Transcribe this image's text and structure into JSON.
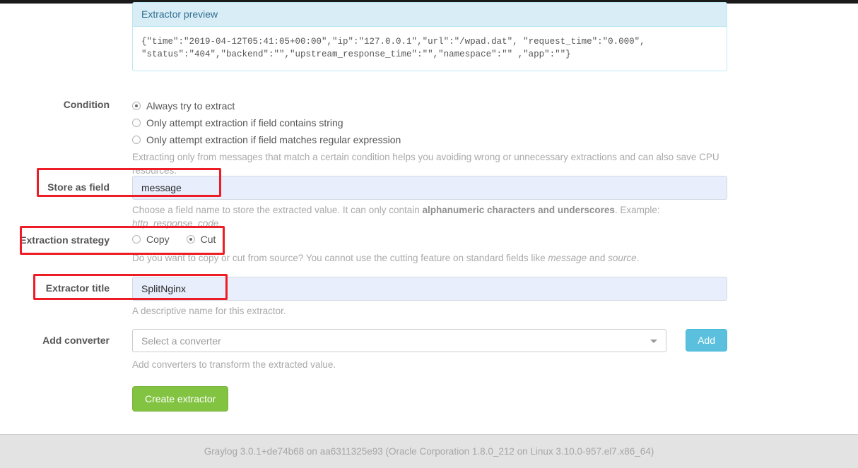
{
  "preview": {
    "heading": "Extractor preview",
    "content": "{\"time\":\"2019-04-12T05:41:05+00:00\",\"ip\":\"127.0.0.1\",\"url\":\"/wpad.dat\", \"request_time\":\"0.000\",\n\"status\":\"404\",\"backend\":\"\",\"upstream_response_time\":\"\",\"namespace\":\"\" ,\"app\":\"\"}"
  },
  "condition": {
    "label": "Condition",
    "options": [
      {
        "label": "Always try to extract",
        "checked": true
      },
      {
        "label": "Only attempt extraction if field contains string",
        "checked": false
      },
      {
        "label": "Only attempt extraction if field matches regular expression",
        "checked": false
      }
    ],
    "help": "Extracting only from messages that match a certain condition helps you avoiding wrong or unnecessary extractions and can also save CPU resources."
  },
  "store_as_field": {
    "label": "Store as field",
    "value": "message",
    "help_prefix": "Choose a field name to store the extracted value. It can only contain ",
    "help_bold": "alphanumeric characters and underscores",
    "help_middle": ". Example: ",
    "help_italic": "http_response_code",
    "help_suffix": "."
  },
  "extraction_strategy": {
    "label": "Extraction strategy",
    "options": [
      {
        "label": "Copy",
        "checked": false
      },
      {
        "label": "Cut",
        "checked": true
      }
    ],
    "help_prefix": "Do you want to copy or cut from source? You cannot use the cutting feature on standard fields like ",
    "help_italic_1": "message",
    "help_middle": " and ",
    "help_italic_2": "source",
    "help_suffix": "."
  },
  "extractor_title": {
    "label": "Extractor title",
    "value": "SplitNginx",
    "help": "A descriptive name for this extractor."
  },
  "add_converter": {
    "label": "Add converter",
    "placeholder": "Select a converter",
    "button_label": "Add",
    "help": "Add converters to transform the extracted value."
  },
  "submit": {
    "label": "Create extractor"
  },
  "footer": {
    "text": "Graylog 3.0.1+de74b68 on aa6311325e93 (Oracle Corporation 1.8.0_212 on Linux 3.10.0-957.el7.x86_64)"
  },
  "colors": {
    "annotation": "#ee1c24",
    "panel_info_bg": "#d9edf7",
    "panel_info_border": "#bce8f1",
    "panel_info_text": "#31708f",
    "btn_info": "#5bc0de",
    "btn_success": "#82c341",
    "input_autofill_bg": "#e8eefb",
    "footer_bg": "#e3e3e3"
  }
}
